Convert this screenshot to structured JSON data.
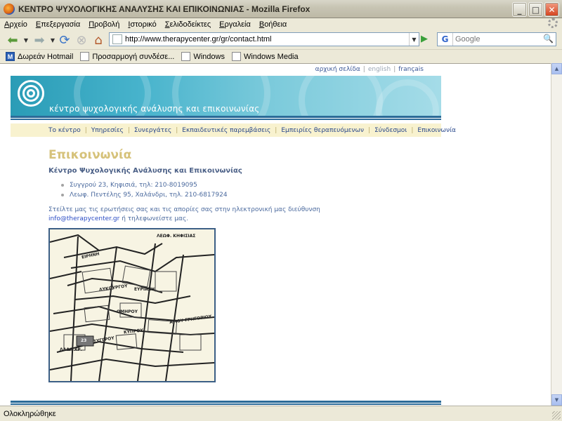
{
  "window": {
    "title": "ΚΕΝΤΡΟ ΨΥΧΟΛΟΓΙΚΗΣ ΑΝΑΛΥΣΗΣ ΚΑΙ ΕΠΙΚΟΙΝΩΝΙΑΣ - Mozilla Firefox"
  },
  "menu": [
    "Αρχείο",
    "Επεξεργασία",
    "Προβολή",
    "Ιστορικό",
    "Σελιδοδείκτες",
    "Εργαλεία",
    "Βοήθεια"
  ],
  "toolbar": {
    "url": "http://www.therapycenter.gr/gr/contact.html",
    "search_engine": "G",
    "search_placeholder": "Google"
  },
  "bookmarks": [
    "Δωρεάν Hotmail",
    "Προσαρμογή συνδέσε...",
    "Windows",
    "Windows Media"
  ],
  "site": {
    "lang": {
      "home": "αρχική σελίδα",
      "english": "english",
      "french": "français"
    },
    "tagline": "κέντρο ψυχολογικής ανάλυσης και επικοινωνίας",
    "nav": [
      "Το κέντρο",
      "Υπηρεσίες",
      "Συνεργάτες",
      "Εκπαιδευτικές παρεμβάσεις",
      "Εμπειρίες θεραπευόμενων",
      "Σύνδεσμοι",
      "Επικοινωνία"
    ],
    "heading": "Επικοινωνία",
    "subheading": "Κέντρο Ψυχολογικής Ανάλυσης και Επικοινωνίας",
    "addresses": [
      "Συγγρού 23, Κηφισιά, τηλ: 210-8019095",
      "Λεωφ. Πεντέλης 95, Χαλάνδρι, τηλ. 210-6817924"
    ],
    "contact_text": "Στείλτε μας τις ερωτήσεις σας και τις απορίες σας στην ηλεκτρονική μας διεύθυνση",
    "email": "info@therapycenter.gr",
    "contact_suffix": "ή τηλεφωνείστε μας.",
    "map_labels": {
      "kifisias": "ΛΕΩΦ. ΚΗΦΙΣΙΑΣ",
      "eirini": "ΕΙΡΗΝΗ",
      "lykourgou": "ΛΥΚΟΥΡΓΟΥ",
      "evriazi": "ΕΥΡΙΑΖΗ",
      "omirou": "ΟΜΗΡΟΥ",
      "grigoriou": "ΑΓΙΟΥ ΓΡΗΓΟΡΙΟΥ",
      "kyprou": "ΚΥΠΡΟΥ",
      "syggrou": "ΣΥΓΓΡΟΥ",
      "lada": "ΛΑΔΑ ΧΡ.",
      "num": "23"
    }
  },
  "status": "Ολοκληρώθηκε"
}
